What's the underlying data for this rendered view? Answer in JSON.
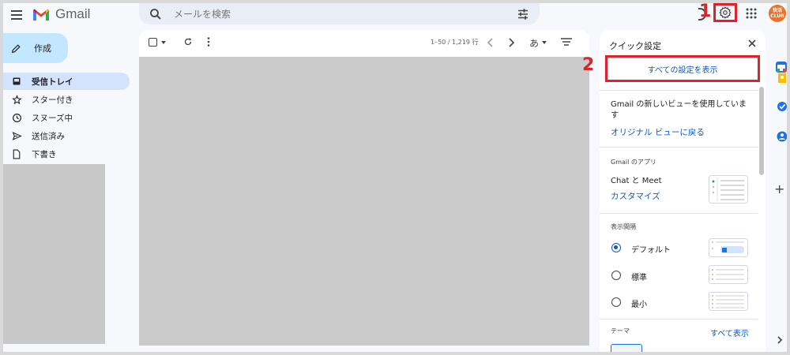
{
  "header": {
    "app_name": "Gmail",
    "search_placeholder": "メールを検索"
  },
  "annotations": {
    "step1": "1",
    "step2": "2"
  },
  "avatar": {
    "line1": "快活",
    "line2": "CLUB"
  },
  "sidebar": {
    "compose_label": "作成",
    "items": [
      {
        "label": "受信トレイ",
        "icon": "inbox-icon",
        "active": true
      },
      {
        "label": "スター付き",
        "icon": "star-icon"
      },
      {
        "label": "スヌーズ中",
        "icon": "clock-icon"
      },
      {
        "label": "送信済み",
        "icon": "send-icon"
      },
      {
        "label": "下書き",
        "icon": "draft-icon"
      }
    ]
  },
  "toolbar": {
    "count": "1–50 / 1,219 行",
    "lang": "あ"
  },
  "quick_settings": {
    "title": "クイック設定",
    "all_settings_label": "すべての設定を表示",
    "new_view_text": "Gmail の新しいビューを使用しています",
    "original_view_link": "オリジナル ビューに戻る",
    "apps_heading": "Gmail のアプリ",
    "chat_meet": "Chat と Meet",
    "customize_link": "カスタマイズ",
    "density_heading": "表示間隔",
    "density_options": [
      "デフォルト",
      "標準",
      "最小"
    ],
    "theme_heading": "テーマ",
    "theme_show_all": "すべて表示"
  },
  "colors": {
    "accent_blue": "#0b57d0",
    "highlight_red": "#e0202a",
    "compose_bg": "#c2e7ff",
    "active_nav_bg": "#d3e3fd"
  }
}
